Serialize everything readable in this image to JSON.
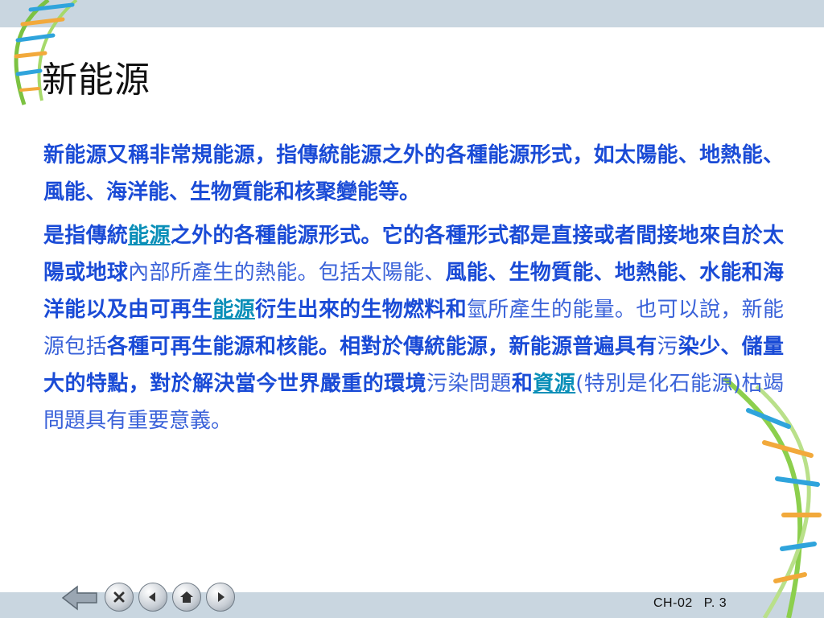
{
  "slide": {
    "title": "新能源",
    "paragraph1": "新能源又稱非常規能源，指傳統能源之外的各種能源形式，如太陽能、地熱能、風能、海洋能、生物質能和核聚變能等。",
    "paragraph2": {
      "seg1": "是指傳統",
      "link1": "能源",
      "seg2": "之外的各種能源形式。它的各種形式都是直接或者間接地來自於太陽或地球",
      "seg3": "內部所產生的熱能。包括太陽能、",
      "seg4": "風能、生物質能、地熱能、水能和海洋能以及由可再生",
      "link2": "能源",
      "seg5": "衍生出來的生物燃料和",
      "seg6": "氫所產生的能量。也可以說，新能源包括",
      "seg7": "各種可再生能源和核能。相對於傳統能源，新能源普遍具有",
      "seg8": "污",
      "seg9": "染少、儲量大的特點，對於解決當今世界嚴重的環境",
      "seg10": "污染問題",
      "seg11": "和",
      "link3": "資源",
      "seg12": "(特別是化石能源)枯竭問題具有重要意義。"
    }
  },
  "footer": {
    "chapter": "CH-02",
    "page": "P. 3"
  },
  "navigation": {
    "icons": [
      "back-arrow-icon",
      "close-icon",
      "previous-icon",
      "home-icon",
      "next-icon"
    ]
  },
  "colors": {
    "body_text": "#1a4bd6",
    "link": "#0a8fb8",
    "bar": "#c9d6e0"
  }
}
